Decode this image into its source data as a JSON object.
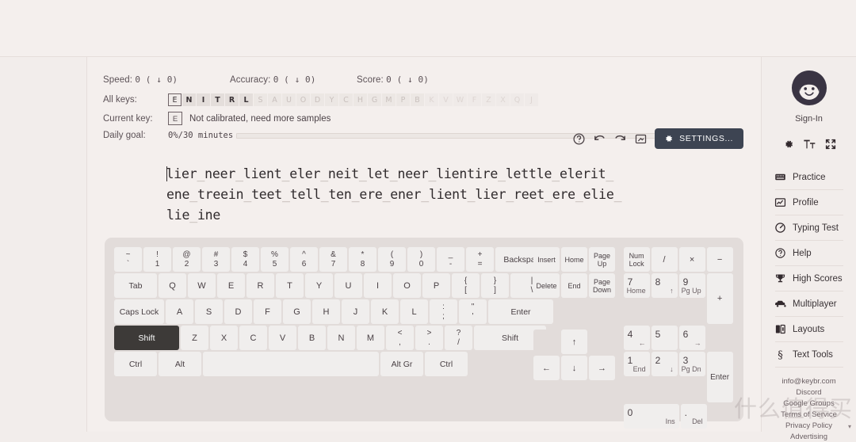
{
  "stats": {
    "speed_label": "Speed:",
    "speed_value": "0 ( ↓ 0)",
    "accuracy_label": "Accuracy:",
    "accuracy_value": "0 ( ↓ 0)",
    "score_label": "Score:",
    "score_value": "0 ( ↓ 0)"
  },
  "allkeys": {
    "label": "All keys:",
    "letters": [
      "E",
      "N",
      "I",
      "T",
      "R",
      "L",
      "S",
      "A",
      "U",
      "O",
      "D",
      "Y",
      "C",
      "H",
      "G",
      "M",
      "P",
      "B",
      "K",
      "V",
      "W",
      "F",
      "Z",
      "X",
      "Q",
      "J"
    ],
    "active_count": 6,
    "current_index": 0
  },
  "currentkey": {
    "label": "Current key:",
    "key": "E",
    "note": "Not calibrated, need more samples"
  },
  "dailygoal": {
    "label": "Daily goal:",
    "value": "0%/30 minutes",
    "percent": 0
  },
  "toolbar": {
    "help_icon": "question-circle-icon",
    "undo_icon": "undo-icon",
    "redo_icon": "redo-icon",
    "fullscreen_icon": "resize-icon",
    "settings_label": "SETTINGS...",
    "settings_icon": "gear-icon",
    "settings_bg": "#3d4452"
  },
  "typing": {
    "lines": [
      "lier_neer_lient_eler_neit_let_neer_lientire_lettle_elerit_",
      "ene_treein_teet_tell_ten_ere_ener_lient_lier_reet_ere_elie_",
      "lie_ine"
    ]
  },
  "keyboard": {
    "row_numbers": [
      {
        "top": "~",
        "bot": "`",
        "w": "u1"
      },
      {
        "top": "!",
        "bot": "1",
        "w": "u1"
      },
      {
        "top": "@",
        "bot": "2",
        "w": "u1"
      },
      {
        "top": "#",
        "bot": "3",
        "w": "u1"
      },
      {
        "top": "$",
        "bot": "4",
        "w": "u1"
      },
      {
        "top": "%",
        "bot": "5",
        "w": "u1"
      },
      {
        "top": "^",
        "bot": "6",
        "w": "u1"
      },
      {
        "top": "&",
        "bot": "7",
        "w": "u1"
      },
      {
        "top": "*",
        "bot": "8",
        "w": "u1"
      },
      {
        "top": "(",
        "bot": "9",
        "w": "u1"
      },
      {
        "top": ")",
        "bot": "0",
        "w": "u1"
      },
      {
        "top": "_",
        "bot": "-",
        "w": "u1"
      },
      {
        "top": "+",
        "bot": "=",
        "w": "u1"
      },
      {
        "word": "Backspace",
        "w": "u2"
      }
    ],
    "row_top": [
      {
        "word": "Tab",
        "w": "u15"
      },
      {
        "single": "Q",
        "w": "u1"
      },
      {
        "single": "W",
        "w": "u1"
      },
      {
        "single": "E",
        "w": "u1"
      },
      {
        "single": "R",
        "w": "u1"
      },
      {
        "single": "T",
        "w": "u1"
      },
      {
        "single": "Y",
        "w": "u1"
      },
      {
        "single": "U",
        "w": "u1"
      },
      {
        "single": "I",
        "w": "u1"
      },
      {
        "single": "O",
        "w": "u1"
      },
      {
        "single": "P",
        "w": "u1"
      },
      {
        "top": "{",
        "bot": "[",
        "w": "u1"
      },
      {
        "top": "}",
        "bot": "]",
        "w": "u1"
      },
      {
        "top": "|",
        "bot": "\\",
        "w": "u15"
      }
    ],
    "row_home": [
      {
        "word": "Caps Lock",
        "w": "u175"
      },
      {
        "single": "A",
        "w": "u1"
      },
      {
        "single": "S",
        "w": "u1"
      },
      {
        "single": "D",
        "w": "u1"
      },
      {
        "single": "F",
        "w": "u1"
      },
      {
        "single": "G",
        "w": "u1"
      },
      {
        "single": "H",
        "w": "u1"
      },
      {
        "single": "J",
        "w": "u1"
      },
      {
        "single": "K",
        "w": "u1"
      },
      {
        "single": "L",
        "w": "u1"
      },
      {
        "top": ":",
        "bot": ";",
        "w": "u1"
      },
      {
        "top": "\"",
        "bot": "'",
        "w": "u1"
      },
      {
        "word": "Enter",
        "w": "u225"
      }
    ],
    "row_bottom": [
      {
        "word": "Shift",
        "w": "u225",
        "dark": true
      },
      {
        "single": "Z",
        "w": "u1"
      },
      {
        "single": "X",
        "w": "u1"
      },
      {
        "single": "C",
        "w": "u1"
      },
      {
        "single": "V",
        "w": "u1"
      },
      {
        "single": "B",
        "w": "u1"
      },
      {
        "single": "N",
        "w": "u1"
      },
      {
        "single": "M",
        "w": "u1"
      },
      {
        "top": "<",
        "bot": ",",
        "w": "u1"
      },
      {
        "top": ">",
        "bot": ".",
        "w": "u1"
      },
      {
        "top": "?",
        "bot": "/",
        "w": "u1"
      },
      {
        "word": "Shift",
        "w": "u25"
      }
    ],
    "row_space": [
      {
        "word": "Ctrl",
        "w": "u15"
      },
      {
        "word": "Alt",
        "w": "u15"
      },
      {
        "word": "",
        "w": "u6"
      },
      {
        "word": "Alt Gr",
        "w": "u15"
      },
      {
        "word": "Ctrl",
        "w": "u15"
      }
    ],
    "nav_rows": [
      [
        "Insert",
        "Home",
        "Page Up"
      ],
      [
        "Delete",
        "End",
        "Page Down"
      ]
    ],
    "arrows": {
      "up": "↑",
      "left": "←",
      "down": "↓",
      "right": "→"
    },
    "numpad": {
      "r1": [
        {
          "word": "Num Lock"
        },
        {
          "single": "/"
        },
        {
          "single": "×"
        },
        {
          "single": "−"
        }
      ],
      "r2": [
        {
          "main": "7",
          "sub": "Home"
        },
        {
          "main": "8",
          "sub": "↑"
        },
        {
          "main": "9",
          "sub": "Pg Up"
        },
        {
          "plus": "+"
        }
      ],
      "r3": [
        {
          "main": "4",
          "sub": "←"
        },
        {
          "main": "5",
          "sub": ""
        },
        {
          "main": "6",
          "sub": "→"
        }
      ],
      "r4": [
        {
          "main": "1",
          "sub": "End"
        },
        {
          "main": "2",
          "sub": "↓"
        },
        {
          "main": "3",
          "sub": "Pg Dn"
        },
        {
          "enter": "Enter"
        }
      ],
      "r5": [
        {
          "main": "0",
          "sub": "Ins"
        },
        {
          "main": ".",
          "sub": "Del"
        }
      ]
    }
  },
  "sidebar": {
    "signin_label": "Sign-In",
    "avatar_icon": "user-avatar-icon",
    "quick_icons": [
      "gear-icon",
      "font-size-icon",
      "fullscreen-icon"
    ],
    "items": [
      {
        "label": "Practice",
        "icon": "keyboard-icon"
      },
      {
        "label": "Profile",
        "icon": "chart-icon"
      },
      {
        "label": "Typing Test",
        "icon": "speedometer-icon"
      },
      {
        "label": "Help",
        "icon": "question-circle-icon"
      },
      {
        "label": "High Scores",
        "icon": "trophy-icon"
      },
      {
        "label": "Multiplayer",
        "icon": "car-icon"
      },
      {
        "label": "Layouts",
        "icon": "layouts-icon"
      },
      {
        "label": "Text Tools",
        "icon": "section-sign-icon"
      }
    ],
    "links": [
      "info@keybr.com",
      "Discord",
      "Google Groups",
      "Terms of Service",
      "Privacy Policy",
      "Advertising"
    ],
    "watermark": "什么值得买"
  }
}
